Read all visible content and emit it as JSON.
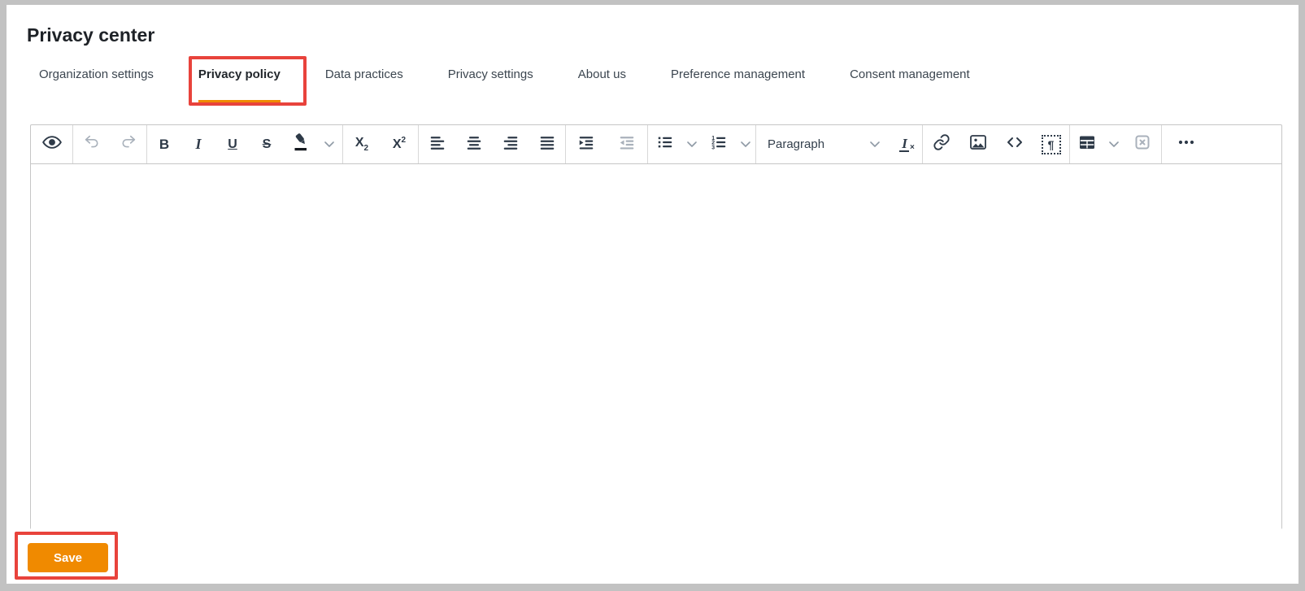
{
  "header": {
    "title": "Privacy center"
  },
  "tabs": [
    {
      "label": "Organization settings",
      "active": false
    },
    {
      "label": "Privacy policy",
      "active": true
    },
    {
      "label": "Data practices",
      "active": false
    },
    {
      "label": "Privacy settings",
      "active": false
    },
    {
      "label": "About us",
      "active": false
    },
    {
      "label": "Preference management",
      "active": false
    },
    {
      "label": "Consent management",
      "active": false
    }
  ],
  "toolbar": {
    "bold": "B",
    "italic": "I",
    "underline": "U",
    "strikethrough": "S",
    "subscript_base": "X",
    "subscript_small": "2",
    "superscript_base": "X",
    "superscript_small": "2",
    "paragraph_dropdown": "Paragraph",
    "remove_format_base": "I",
    "remove_format_small": "×",
    "html_embed": "¶"
  },
  "editor": {
    "content": ""
  },
  "footer": {
    "save_label": "Save"
  },
  "colors": {
    "accent_orange": "#f08a00",
    "annotation_red": "#e8433c",
    "icon": "#2e3a48",
    "icon_disabled": "#a9b1bb",
    "frame_gray": "#c2c2c2"
  }
}
